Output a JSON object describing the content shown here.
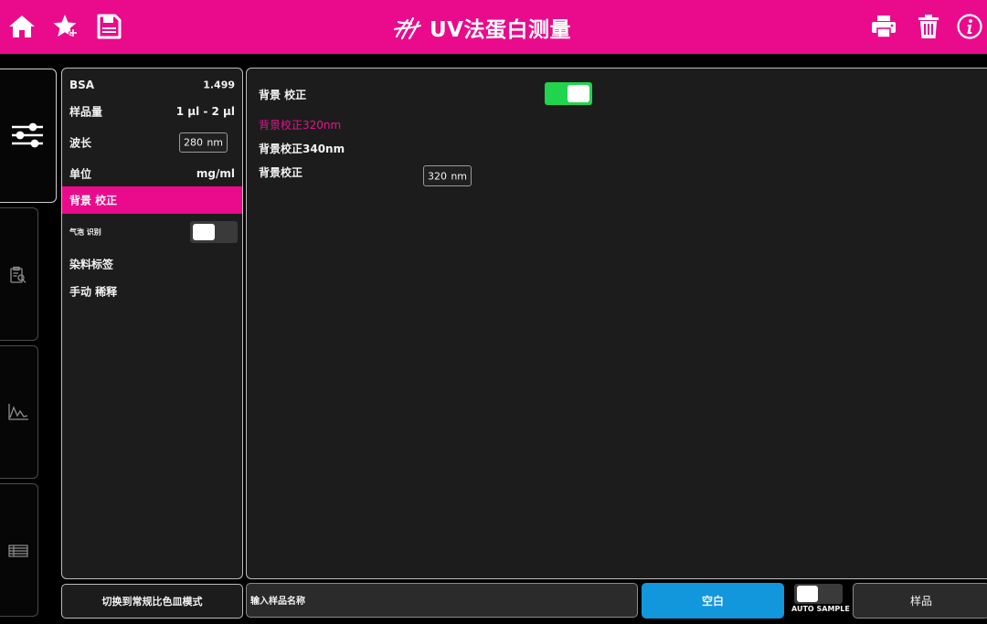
{
  "header": {
    "title": "UV法蛋白测量",
    "left_icons": [
      "home-icon",
      "favorite-star-icon",
      "save-icon"
    ],
    "right_icons": [
      "print-icon",
      "trash-icon",
      "info-icon"
    ]
  },
  "rail": {
    "icons": [
      "settings-sliders-icon",
      "clipboard-search-icon",
      "chart-icon",
      "table-icon"
    ]
  },
  "settings": {
    "standard_name": "BSA",
    "standard_value": "1.499",
    "sample_volume_label": "样品量",
    "sample_volume_value": "1 µl - 2 µl",
    "wavelength_label": "波长",
    "wavelength_value": "280",
    "wavelength_unit": "nm",
    "unit_label": "单位",
    "unit_value": "mg/ml",
    "background_correction_label": "背景 校正",
    "bubble_detection_label": "气泡 识别",
    "bubble_detection_on": false,
    "dye_label_label": "染料标签",
    "manual_dilution_label": "手动 稀释"
  },
  "detail": {
    "background_correction_label": "背景 校正",
    "background_correction_on": true,
    "option_320_label": "背景校正320nm",
    "option_340_label": "背景校正340nm",
    "wavelength_label": "背景校正",
    "wavelength_value": "320",
    "wavelength_unit": "nm"
  },
  "bottom": {
    "switch_mode_label": "切换到常规比色皿模式",
    "sample_name_placeholder": "输入样品名称",
    "blank_label": "空白",
    "auto_sample_label": "AUTO SAMPLE",
    "auto_sample_on": false,
    "sample_label": "样品"
  },
  "colors": {
    "accent": "#ea0a8c",
    "toggle_on": "#21d44e",
    "blank_button": "#1296dc",
    "panel_bg": "#1c1c1c"
  }
}
